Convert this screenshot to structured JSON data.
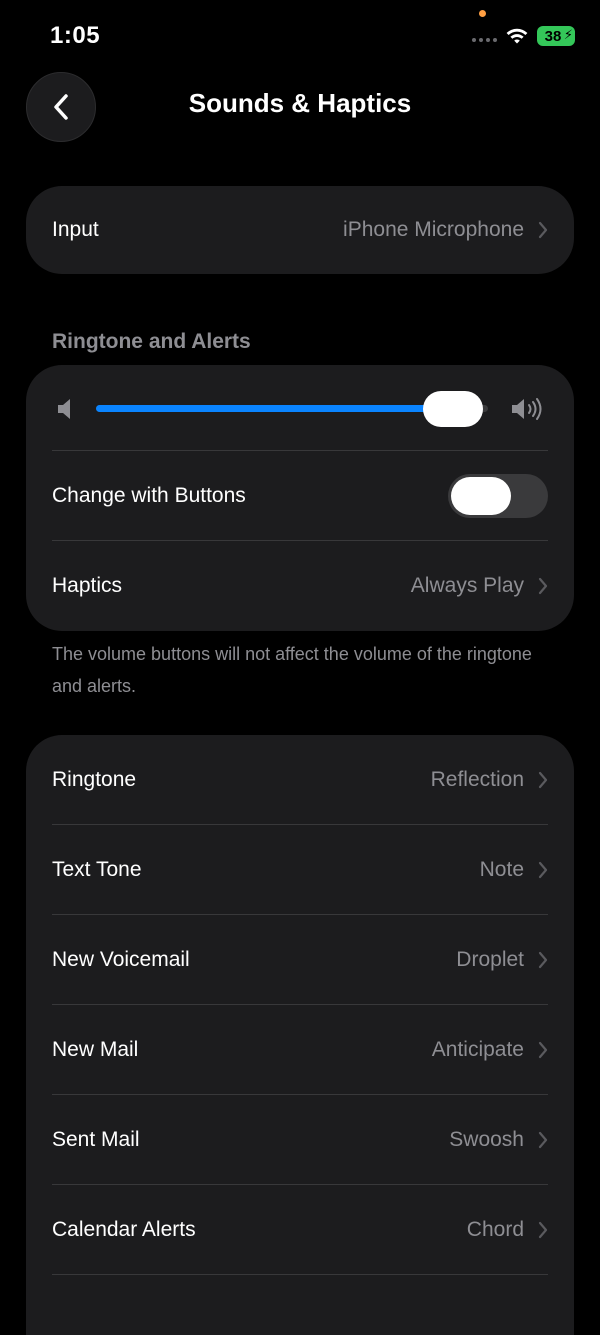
{
  "status_bar": {
    "time": "1:05",
    "battery": "38"
  },
  "nav": {
    "title": "Sounds & Haptics",
    "back_icon": "chevron-left-icon"
  },
  "input_card": {
    "label": "Input",
    "value": "iPhone Microphone"
  },
  "ringtone_section": {
    "header": "Ringtone and Alerts",
    "volume_level": 0.92,
    "change_with_buttons_label": "Change with Buttons",
    "change_with_buttons_on": false,
    "haptics_label": "Haptics",
    "haptics_value": "Always Play",
    "footnote": "The volume buttons will not affect the volume of the ringtone and alerts."
  },
  "sounds_list": [
    {
      "label": "Ringtone",
      "value": "Reflection"
    },
    {
      "label": "Text Tone",
      "value": "Note"
    },
    {
      "label": "New Voicemail",
      "value": "Droplet"
    },
    {
      "label": "New Mail",
      "value": "Anticipate"
    },
    {
      "label": "Sent Mail",
      "value": "Swoosh"
    },
    {
      "label": "Calendar Alerts",
      "value": "Chord"
    }
  ],
  "colors": {
    "background": "#000000",
    "card": "#1c1c1e",
    "accent": "#0a84ff",
    "secondary_text": "#8e8e93",
    "battery": "#34c759"
  }
}
